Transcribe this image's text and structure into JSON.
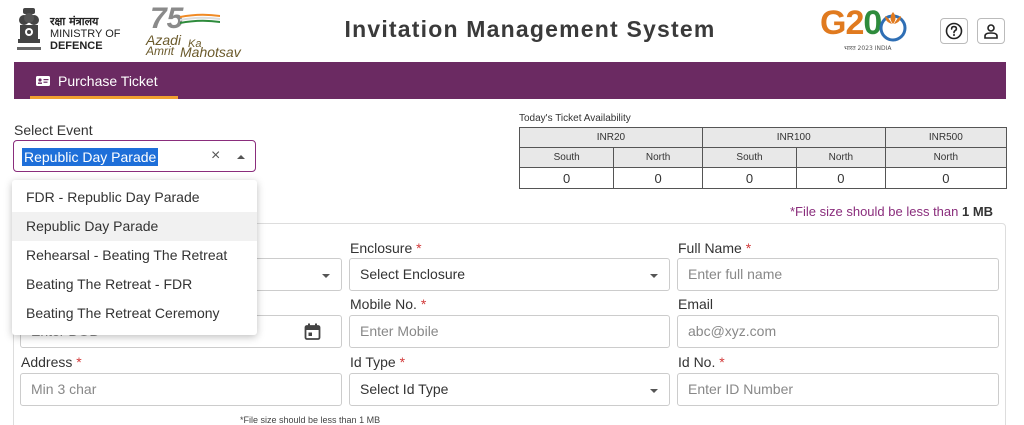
{
  "header": {
    "mod_hindi": "रक्षा मंत्रालय",
    "mod_line1": "MINISTRY OF",
    "mod_line2": "DEFENCE",
    "azadi_75": "75",
    "azadi_t1": "Azadi",
    "azadi_t1b": "Ka",
    "azadi_t2": "Amrit",
    "azadi_t3": "Mahotsav",
    "title": "Invitation Management System",
    "g20_text_g2": "G2",
    "g20_text_0": "0",
    "g20_sub": "भारत 2023 INDIA"
  },
  "nav": {
    "tab_label": "Purchase Ticket"
  },
  "select_event": {
    "label": "Select Event",
    "value": "Republic Day Parade",
    "clear_symbol": "×",
    "options": [
      "FDR - Republic Day Parade",
      "Republic Day Parade",
      "Rehearsal - Beating The Retreat",
      "Beating The Retreat - FDR",
      "Beating The Retreat Ceremony"
    ],
    "highlighted_index": 1
  },
  "availability": {
    "title": "Today's Ticket Availability",
    "groups": [
      "INR20",
      "INR100",
      "INR500"
    ],
    "columns": [
      "South",
      "North",
      "South",
      "North",
      "North"
    ],
    "values": [
      "0",
      "0",
      "0",
      "0",
      "0"
    ]
  },
  "file_note": {
    "text": "*File size should be less than ",
    "bold": "1 MB"
  },
  "form": {
    "enclosure_label": "Enclosure",
    "enclosure_value": "Select Enclosure",
    "fullname_label": "Full Name",
    "fullname_placeholder": "Enter full name",
    "dob_placeholder": "Enter DOB",
    "mobile_label": "Mobile No.",
    "mobile_placeholder": "Enter Mobile",
    "email_label": "Email",
    "email_placeholder": "abc@xyz.com",
    "address_label": "Address",
    "address_placeholder": "Min 3 char",
    "idtype_label": "Id Type",
    "idtype_value": "Select Id Type",
    "idno_label": "Id No.",
    "idno_placeholder": "Enter ID Number",
    "required_mark": "*"
  },
  "bottom_note": "*File size should be less than 1 MB",
  "colors": {
    "nav_bg": "#6b2a62",
    "accent": "#8a2d7c",
    "tab_underline": "#f0a030",
    "selection": "#1e6fd9"
  }
}
